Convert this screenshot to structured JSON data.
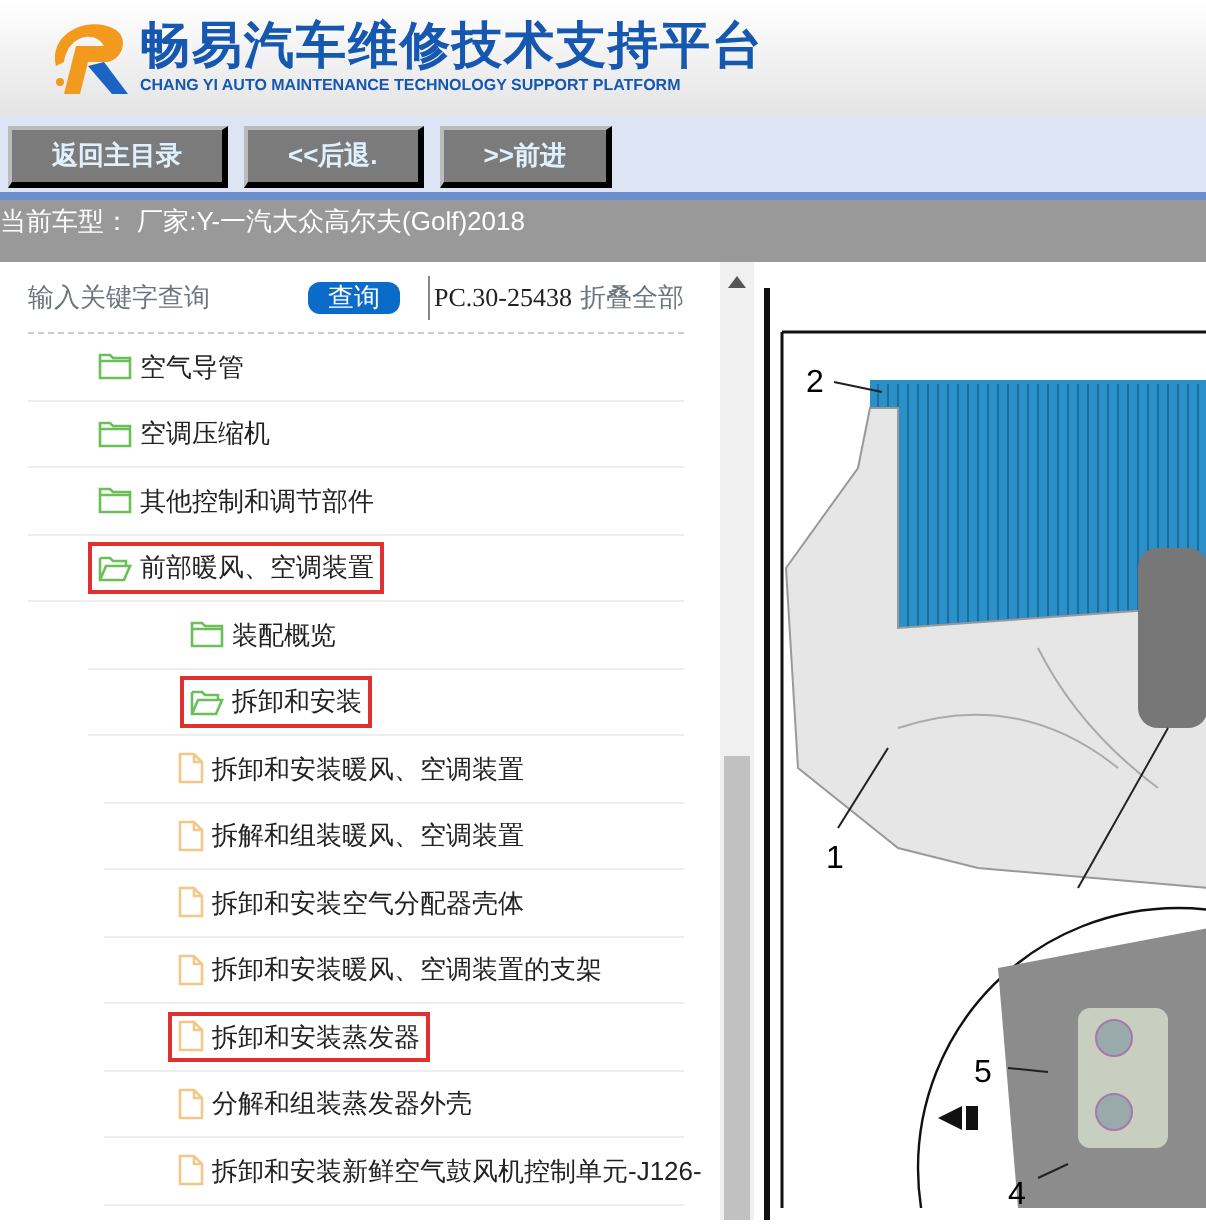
{
  "header": {
    "title": "畅易汽车维修技术支持平台",
    "subtitle": "CHANG YI AUTO MAINTENANCE TECHNOLOGY SUPPORT PLATFORM"
  },
  "nav_buttons": [
    "返回主目录",
    "<<后退.",
    ">>前进"
  ],
  "vehicle_bar": {
    "text": "当前车型： 厂家:Y-一汽大众高尔夫(Golf)2018"
  },
  "search": {
    "placeholder": "输入关键字查询",
    "button": "查询",
    "code": "PC.30-25438",
    "collapse_all": "折叠全部"
  },
  "tree": [
    {
      "label": "空气导管",
      "kind": "folder",
      "expanded": false,
      "highlighted": false
    },
    {
      "label": "空调压缩机",
      "kind": "folder",
      "expanded": false,
      "highlighted": false
    },
    {
      "label": "其他控制和调节部件",
      "kind": "folder",
      "expanded": false,
      "highlighted": false
    },
    {
      "label": "前部暖风、空调装置",
      "kind": "folder",
      "expanded": true,
      "highlighted": true,
      "children": [
        {
          "label": "装配概览",
          "kind": "folder",
          "expanded": false,
          "highlighted": false
        },
        {
          "label": "拆卸和安装",
          "kind": "folder",
          "expanded": true,
          "highlighted": true,
          "children": [
            {
              "label": "拆卸和安装暖风、空调装置",
              "kind": "file",
              "highlighted": false
            },
            {
              "label": "拆解和组装暖风、空调装置",
              "kind": "file",
              "highlighted": false
            },
            {
              "label": "拆卸和安装空气分配器壳体",
              "kind": "file",
              "highlighted": false
            },
            {
              "label": "拆卸和安装暖风、空调装置的支架",
              "kind": "file",
              "highlighted": false
            },
            {
              "label": "拆卸和安装蒸发器",
              "kind": "file",
              "highlighted": true
            },
            {
              "label": "分解和组装蒸发器外壳",
              "kind": "file",
              "highlighted": false
            },
            {
              "label": "拆卸和安装新鲜空气鼓风机控制单元-J126-",
              "kind": "file",
              "highlighted": false
            }
          ]
        }
      ]
    }
  ],
  "diagram": {
    "callouts": [
      "2",
      "1",
      "5",
      "4"
    ]
  }
}
